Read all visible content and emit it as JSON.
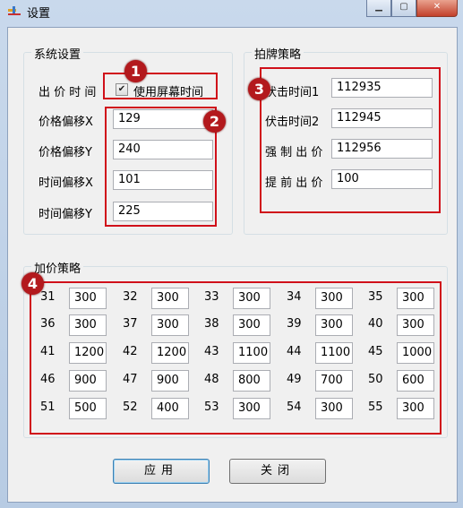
{
  "window": {
    "title": "设置",
    "minimize": "▁",
    "maximize": "▢",
    "close": "✕"
  },
  "system_settings": {
    "title": "系统设置",
    "bid_time_label": "出 价 时 间",
    "use_screen_time_label": "使用屏幕时间",
    "use_screen_time_checked": true,
    "price_offset_x_label": "价格偏移X",
    "price_offset_x": "129",
    "price_offset_y_label": "价格偏移Y",
    "price_offset_y": "240",
    "time_offset_x_label": "时间偏移X",
    "time_offset_x": "101",
    "time_offset_y_label": "时间偏移Y",
    "time_offset_y": "225"
  },
  "auction_strategy": {
    "title": "拍牌策略",
    "ambush_time1_label": "伏击时间1",
    "ambush_time1": "112935",
    "ambush_time2_label": "伏击时间2",
    "ambush_time2": "112945",
    "forced_bid_label": "强 制 出 价",
    "forced_bid": "112956",
    "early_bid_label": "提 前 出 价",
    "early_bid": "100"
  },
  "markup_strategy": {
    "title": "加价策略",
    "rows": [
      [
        {
          "sec": "31",
          "val": "300"
        },
        {
          "sec": "32",
          "val": "300"
        },
        {
          "sec": "33",
          "val": "300"
        },
        {
          "sec": "34",
          "val": "300"
        },
        {
          "sec": "35",
          "val": "300"
        }
      ],
      [
        {
          "sec": "36",
          "val": "300"
        },
        {
          "sec": "37",
          "val": "300"
        },
        {
          "sec": "38",
          "val": "300"
        },
        {
          "sec": "39",
          "val": "300"
        },
        {
          "sec": "40",
          "val": "300"
        }
      ],
      [
        {
          "sec": "41",
          "val": "1200"
        },
        {
          "sec": "42",
          "val": "1200"
        },
        {
          "sec": "43",
          "val": "1100"
        },
        {
          "sec": "44",
          "val": "1100"
        },
        {
          "sec": "45",
          "val": "1000"
        }
      ],
      [
        {
          "sec": "46",
          "val": "900"
        },
        {
          "sec": "47",
          "val": "900"
        },
        {
          "sec": "48",
          "val": "800"
        },
        {
          "sec": "49",
          "val": "700"
        },
        {
          "sec": "50",
          "val": "600"
        }
      ],
      [
        {
          "sec": "51",
          "val": "500"
        },
        {
          "sec": "52",
          "val": "400"
        },
        {
          "sec": "53",
          "val": "300"
        },
        {
          "sec": "54",
          "val": "300"
        },
        {
          "sec": "55",
          "val": "300"
        }
      ]
    ]
  },
  "annotations": {
    "b1": "1",
    "b2": "2",
    "b3": "3",
    "b4": "4",
    "color": "#d0101a"
  },
  "buttons": {
    "apply": "应用",
    "close": "关闭"
  }
}
